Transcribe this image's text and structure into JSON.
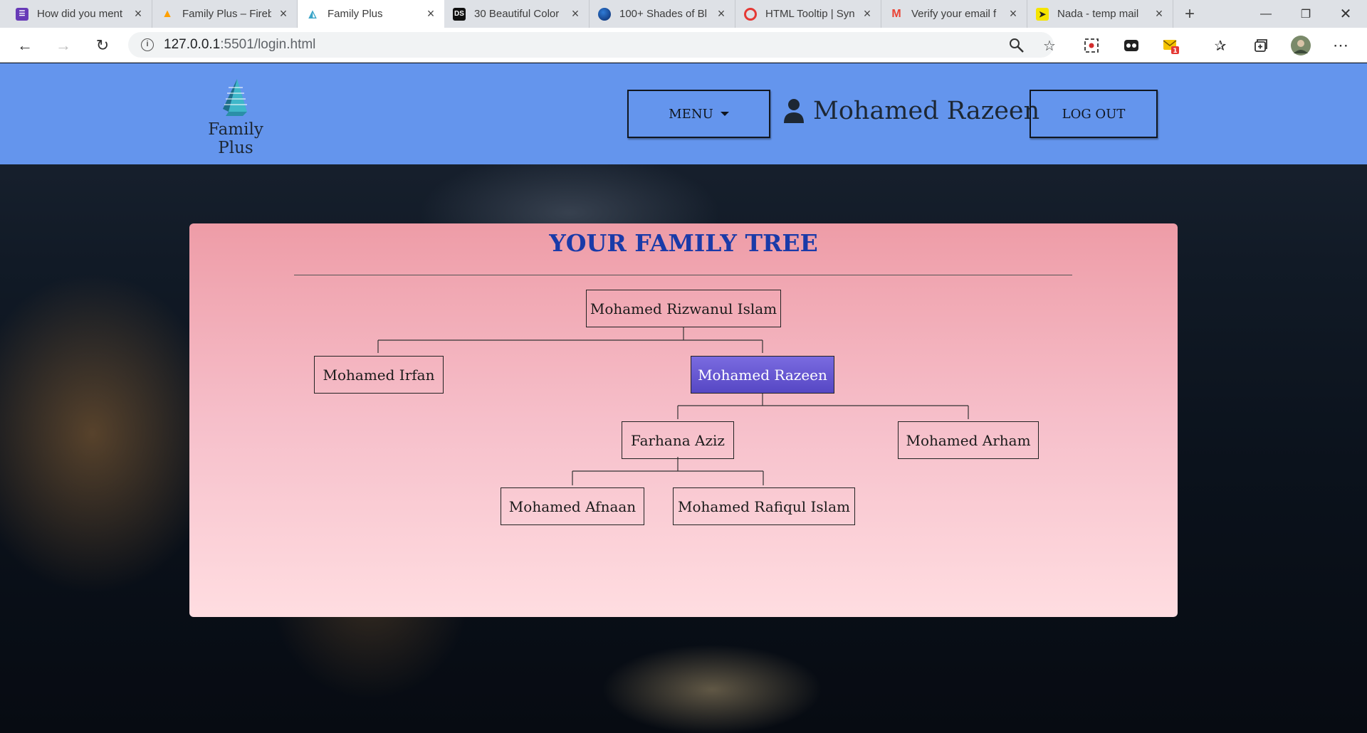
{
  "browser": {
    "tabs": [
      {
        "title": "How did you ment",
        "favicon": "form-icon",
        "color": "#673ab7"
      },
      {
        "title": "Family Plus – Fireb",
        "favicon": "firebase-icon",
        "color": "#ffa000"
      },
      {
        "title": "Family Plus",
        "favicon": "family-plus-icon",
        "color": "#5bc0de",
        "active": true
      },
      {
        "title": "30 Beautiful Color",
        "favicon": "ds-icon",
        "color": "#111111"
      },
      {
        "title": "100+ Shades of Bl",
        "favicon": "globe-icon",
        "color": "#0a3a8a"
      },
      {
        "title": "HTML Tooltip | Syn",
        "favicon": "syncfusion-icon",
        "color": "#e53935"
      },
      {
        "title": "Verify your email f",
        "favicon": "gmail-icon",
        "color": "#ea4335"
      },
      {
        "title": "Nada - temp mail",
        "favicon": "nada-icon",
        "color": "#f5e400"
      }
    ],
    "url_host": "127.0.0.1",
    "url_rest": ":5501/login.html",
    "notification_count": "1"
  },
  "header": {
    "logo_text": "Family Plus",
    "menu_label": "MENU",
    "user_name": "Mohamed Razeen",
    "logout_label": "LOG OUT"
  },
  "tree": {
    "title": "YOUR FAMILY TREE",
    "root": "Mohamed Rizwanul Islam",
    "sibling": "Mohamed Irfan",
    "self": "Mohamed Razeen",
    "spouse": "Farhana Aziz",
    "other_child": "Mohamed Arham",
    "grandchild_1": "Mohamed Afnaan",
    "grandchild_2": "Mohamed Rafiqul Islam"
  },
  "colors": {
    "header": "#6495ed",
    "title": "#1a3aa8",
    "card_top": "#ee9ca7",
    "card_bottom": "#ffdde1",
    "self_node": "#6a5acd"
  }
}
